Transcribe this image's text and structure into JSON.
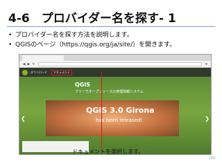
{
  "slide": {
    "title": "4-6　プロバイダー名を探す- 1",
    "bullets": [
      "プロバイダー名を探す方法を説明します。",
      "QGISのページ（https://qgis.org/ja/site/）を開きます。"
    ],
    "callout": "ドキュメントを選択します。",
    "page_number": "100"
  },
  "browser": {
    "nav_items": [
      "ダウンロード",
      "ドキュメント"
    ],
    "hero_heading": "QGIS",
    "hero_tagline": "フリーでオープンソースの地理情報システム",
    "promo_title": "QGIS 3.0 Girona",
    "promo_subtitle": "has been released!"
  },
  "colors": {
    "accent_red": "#e4112b",
    "qgis_green": "#93b023"
  }
}
